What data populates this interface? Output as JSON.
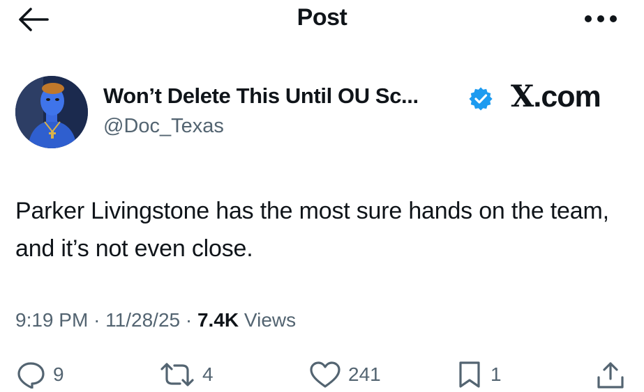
{
  "header": {
    "title": "Post",
    "back_icon": "arrow-left-icon",
    "more_icon": "more-horizontal-icon"
  },
  "author": {
    "display_name": "Won’t Delete This Until OU Sc...",
    "handle": "@Doc_Texas",
    "verified_icon": "verified-badge-icon",
    "verified_color": "#1d9bf0"
  },
  "watermark": {
    "x": "X",
    "rest": ".com"
  },
  "tweet": {
    "text": "Parker Livingstone has the most sure hands on the team, and it’s not even close."
  },
  "meta": {
    "time": "9:19 PM",
    "sep1": "·",
    "date": "11/28/25",
    "sep2": "·",
    "views_count": "7.4K",
    "views_label": "Views"
  },
  "actions": {
    "replies": "9",
    "reposts": "4",
    "likes": "241",
    "bookmarks": "1"
  },
  "colors": {
    "text": "#0f1419",
    "secondary": "#536471",
    "accent": "#1d9bf0"
  }
}
